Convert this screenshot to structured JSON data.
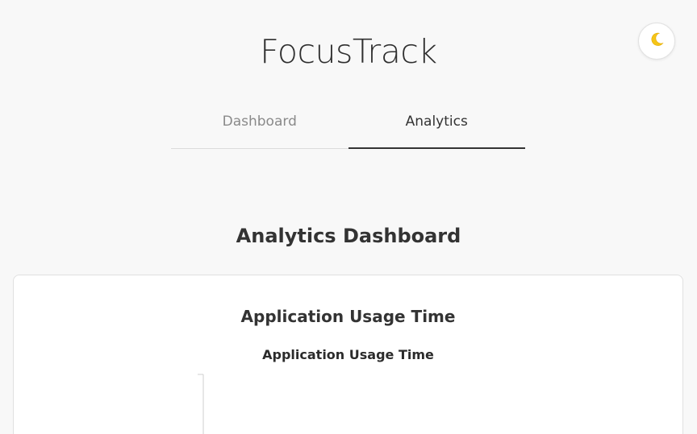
{
  "app": {
    "title": "FocusTrack",
    "theme_toggle_icon": "moon-icon"
  },
  "tabs": [
    {
      "label": "Dashboard",
      "active": false
    },
    {
      "label": "Analytics",
      "active": true
    }
  ],
  "main": {
    "heading": "Analytics Dashboard",
    "card": {
      "title": "Application Usage Time",
      "chart_title": "Application Usage Time"
    }
  },
  "colors": {
    "background": "#f8f8f8",
    "moon": "#f5c518",
    "active_tab_underline": "#333333"
  }
}
